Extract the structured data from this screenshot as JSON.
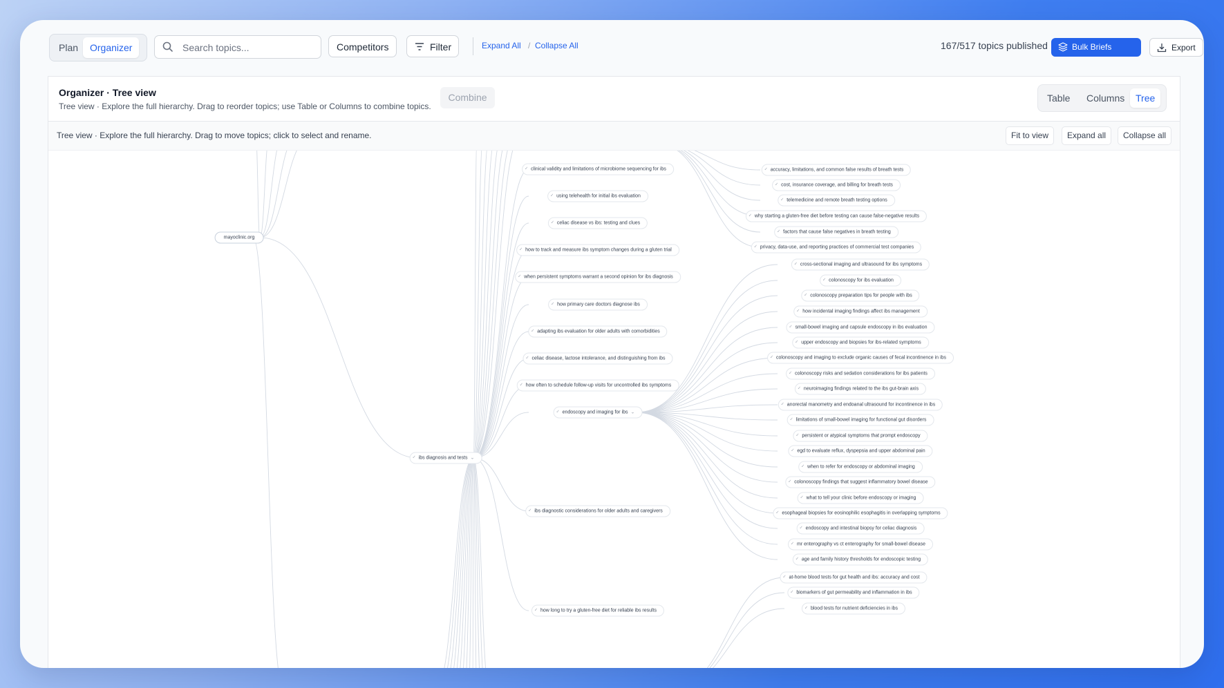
{
  "toolbar": {
    "mode_tabs": [
      "Plan",
      "Organizer"
    ],
    "search_placeholder": "Search topics...",
    "competitors_label": "Competitors",
    "filter_label": "Filter",
    "expand_all_label": "Expand All",
    "separator": "/",
    "collapse_all_label": "Collapse All",
    "published_status": "167/517 topics published",
    "bulk_briefs_label": "Bulk Briefs",
    "export_label": "Export"
  },
  "panel": {
    "title": "Organizer · Tree view",
    "subtitle": "Tree view · Explore the full hierarchy. Drag to reorder topics; use Table or Columns to combine topics.",
    "combine_label": "Combine",
    "view_tabs": [
      "Table",
      "Columns",
      "Tree"
    ],
    "active_view": "Tree"
  },
  "tree_header": {
    "text": "Tree view · Explore the full hierarchy. Drag to move topics; click to select and rename.",
    "fit_label": "Fit to view",
    "expand_label": "Expand all",
    "collapse_label": "Collapse all"
  },
  "tree": {
    "root": "mayoclinic.org",
    "hub": "ibs diagnosis and tests",
    "mid_nodes": [
      "clinical validity and limitations of microbiome sequencing for ibs",
      "using telehealth for initial ibs evaluation",
      "celiac disease vs ibs: testing and clues",
      "how to track and measure ibs symptom changes during a gluten trial",
      "when persistent symptoms warrant a second opinion for ibs diagnosis",
      "how primary care doctors diagnose ibs",
      "adapting ibs evaluation for older adults with comorbidities",
      "celiac disease, lactose intolerance, and distinguishing from ibs",
      "how often to schedule follow-up visits for uncontrolled ibs symptoms",
      "endoscopy and imaging for ibs",
      "ibs diagnostic considerations for older adults and caregivers",
      "how long to try a gluten-free diet for reliable ibs results"
    ],
    "breath_nodes": [
      "accuracy, limitations, and common false results of breath tests",
      "cost, insurance coverage, and billing for breath tests",
      "telemedicine and remote breath testing options",
      "why starting a gluten-free diet before testing can cause false-negative results",
      "factors that cause false negatives in breath testing",
      "privacy, data-use, and reporting practices of commercial test companies"
    ],
    "endoscopy_children": [
      "cross-sectional imaging and ultrasound for ibs symptoms",
      "colonoscopy for ibs evaluation",
      "colonoscopy preparation tips for people with ibs",
      "how incidental imaging findings affect ibs management",
      "small-bowel imaging and capsule endoscopy in ibs evaluation",
      "upper endoscopy and biopsies for ibs-related symptoms",
      "colonoscopy and imaging to exclude organic causes of fecal incontinence in ibs",
      "colonoscopy risks and sedation considerations for ibs patients",
      "neuroimaging findings related to the ibs gut-brain axis",
      "anorectal manometry and endoanal ultrasound for incontinence in ibs",
      "limitations of small-bowel imaging for functional gut disorders",
      "persistent or atypical symptoms that prompt endoscopy",
      "egd to evaluate reflux, dyspepsia and upper abdominal pain",
      "when to refer for endoscopy or abdominal imaging",
      "colonoscopy findings that suggest inflammatory bowel disease",
      "what to tell your clinic before endoscopy or imaging",
      "esophageal biopsies for eosinophilic esophagitis in overlapping symptoms",
      "endoscopy and intestinal biopsy for celiac diagnosis",
      "mr enterography vs ct enterography for small-bowel disease",
      "age and family history thresholds for endoscopic testing"
    ],
    "blood_nodes": [
      "at-home blood tests for gut health and ibs: accuracy and cost",
      "biomarkers of gut permeability and inflammation in ibs",
      "blood tests for nutrient deficiencies in ibs"
    ]
  }
}
